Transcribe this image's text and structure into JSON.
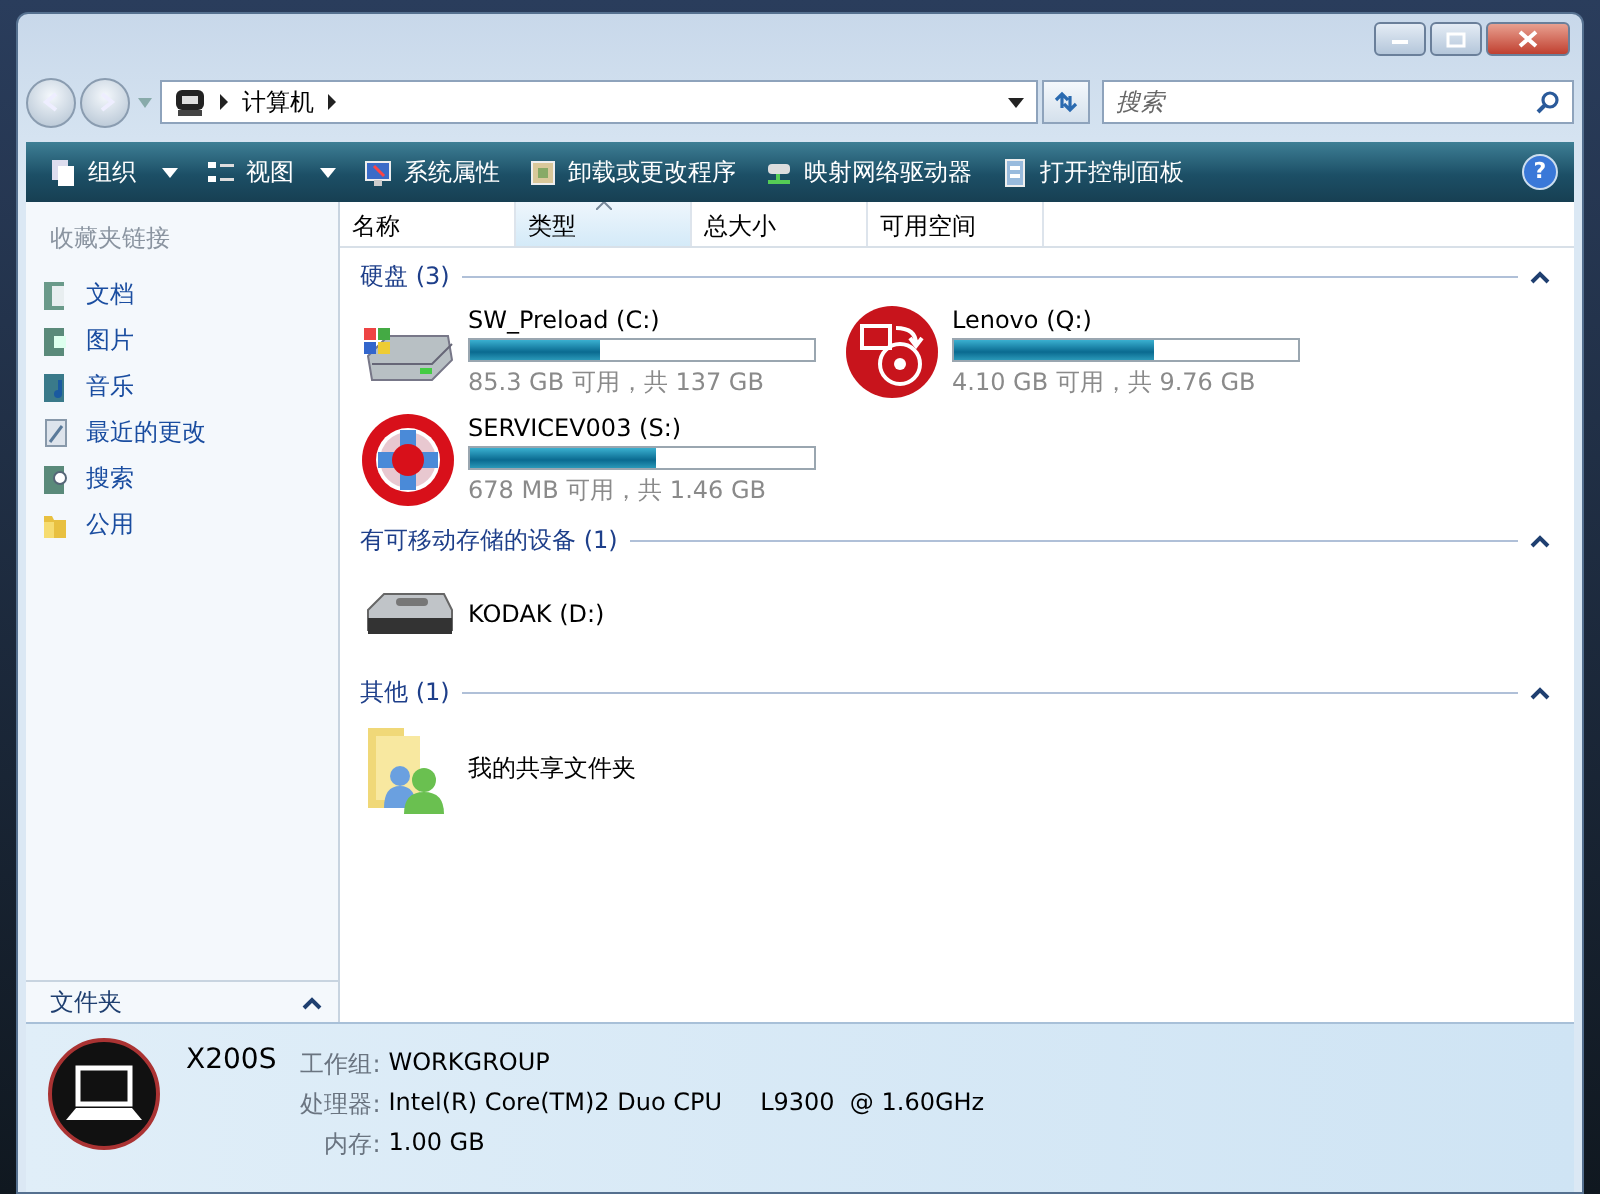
{
  "address": {
    "path": "计算机"
  },
  "search": {
    "placeholder": "搜索"
  },
  "help": "?",
  "toolbar": [
    {
      "label": "组织",
      "kind": "organize",
      "dropdown": true
    },
    {
      "label": "视图",
      "kind": "views",
      "dropdown": true
    },
    {
      "label": "系统属性",
      "kind": "system",
      "dropdown": false
    },
    {
      "label": "卸载或更改程序",
      "kind": "programs",
      "dropdown": false
    },
    {
      "label": "映射网络驱动器",
      "kind": "network",
      "dropdown": false
    },
    {
      "label": "打开控制面板",
      "kind": "control",
      "dropdown": false
    }
  ],
  "sidebar": {
    "title": "收藏夹链接",
    "items": [
      {
        "label": "文档",
        "kind": "documents"
      },
      {
        "label": "图片",
        "kind": "pictures"
      },
      {
        "label": "音乐",
        "kind": "music"
      },
      {
        "label": "最近的更改",
        "kind": "recent"
      },
      {
        "label": "搜索",
        "kind": "search"
      },
      {
        "label": "公用",
        "kind": "public"
      }
    ],
    "folders": "文件夹"
  },
  "columns": [
    {
      "label": "名称",
      "selected": false
    },
    {
      "label": "类型",
      "selected": true
    },
    {
      "label": "总大小",
      "selected": false
    },
    {
      "label": "可用空间",
      "selected": false
    }
  ],
  "groups": [
    {
      "title": "硬盘 (3)",
      "items": [
        {
          "kind": "hdd",
          "name": "SW_Preload (C:)",
          "level": 0.38,
          "free": "85.3 GB 可用，共 137 GB"
        },
        {
          "kind": "recovery",
          "name": "Lenovo (Q:)",
          "level": 0.58,
          "free": "4.10 GB 可用，共 9.76 GB"
        },
        {
          "kind": "service",
          "name": "SERVICEV003 (S:)",
          "level": 0.54,
          "free": "678 MB 可用，共 1.46 GB"
        }
      ]
    },
    {
      "title": "有可移动存储的设备 (1)",
      "items": [
        {
          "kind": "removable",
          "name": "KODAK (D:)"
        }
      ]
    },
    {
      "title": "其他 (1)",
      "items": [
        {
          "kind": "shared",
          "name": "我的共享文件夹"
        }
      ]
    }
  ],
  "details": {
    "name": "X200S",
    "rows": [
      {
        "label": "工作组:",
        "value": "WORKGROUP"
      },
      {
        "label": "处理器:",
        "value": "Intel(R) Core(TM)2 Duo CPU     L9300  @ 1.60GHz"
      },
      {
        "label": "内存:",
        "value": "1.00 GB"
      }
    ]
  }
}
